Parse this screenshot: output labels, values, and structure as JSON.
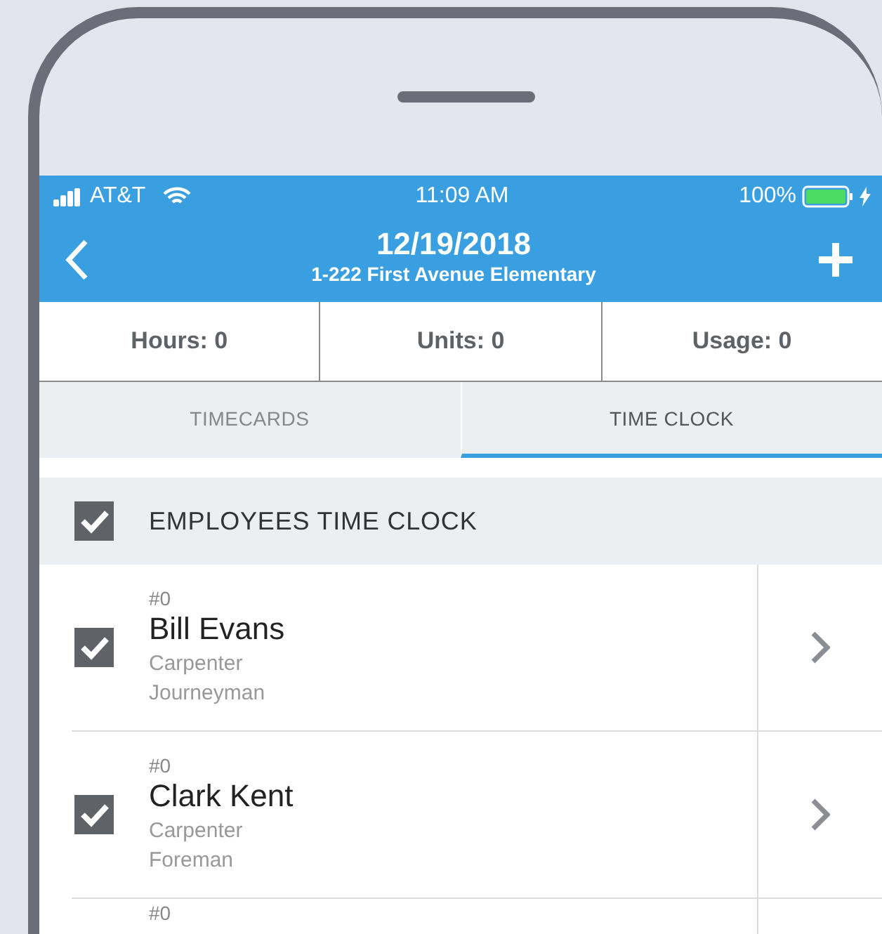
{
  "status_bar": {
    "carrier": "AT&T",
    "time": "11:09 AM",
    "battery": "100%"
  },
  "nav": {
    "title": "12/19/2018",
    "subtitle": "1-222 First Avenue Elementary"
  },
  "stats": [
    "Hours: 0",
    "Units: 0",
    "Usage: 0"
  ],
  "tabs": [
    {
      "label": "TIMECARDS",
      "selected": false
    },
    {
      "label": "TIME CLOCK",
      "selected": true
    }
  ],
  "section": {
    "label": "EMPLOYEES TIME CLOCK",
    "checked": true
  },
  "employees": [
    {
      "number": "#0",
      "name": "Bill Evans",
      "trade": "Carpenter",
      "level": "Journeyman",
      "checked": true
    },
    {
      "number": "#0",
      "name": "Clark Kent",
      "trade": "Carpenter",
      "level": "Foreman",
      "checked": true
    },
    {
      "number": "#0"
    }
  ]
}
